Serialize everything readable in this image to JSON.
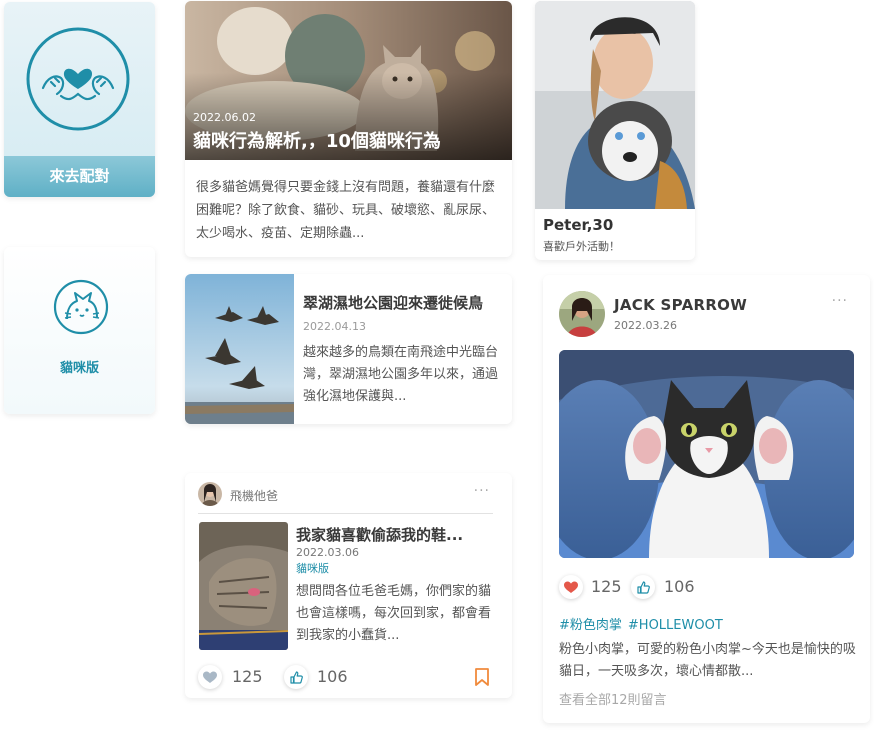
{
  "match_tile": {
    "cta_label": "來去配對",
    "icon": "heart-hands-icon"
  },
  "cat_board_tile": {
    "label": "貓咪版",
    "icon": "cat-face-icon"
  },
  "featured_article": {
    "date": "2022.06.02",
    "title": "貓咪行為解析,，10個貓咪行為",
    "excerpt": "很多貓爸媽覺得只要金錢上沒有問題，養貓還有什麼困難呢？除了飲食、貓砂、玩具、破壞慾、亂尿尿、太少喝水、疫苗、定期除蟲..."
  },
  "profile_card": {
    "name": "Peter,30",
    "bio": "喜歡戶外活動！"
  },
  "bird_article": {
    "title": "翠湖濕地公園迎來遷徙候鳥",
    "date": "2022.04.13",
    "excerpt": "越來越多的鳥類在南飛途中光臨台灣，翠湖濕地公園多年以來，通過強化濕地保護與..."
  },
  "forum_post": {
    "author": "飛機他爸",
    "more": "···",
    "title": "我家貓喜歡偷舔我的鞋...",
    "date": "2022.03.06",
    "board": "貓咪版",
    "excerpt": "想問問各位毛爸毛媽，你們家的貓也會這樣嗎，每次回到家，都會看到我家的小蠢貨...",
    "likes": "125",
    "thumbs": "106"
  },
  "feed_post": {
    "author": "JACK SPARROW",
    "date": "2022.03.26",
    "more": "···",
    "likes": "125",
    "thumbs": "106",
    "tags": [
      "#粉色肉掌",
      "#HOLLEWOOT"
    ],
    "body": "粉色小肉掌，可愛的粉色小肉掌~今天也是愉快的吸貓日，一天吸多次，壞心情都散...",
    "view_comments": "查看全部12則留言"
  },
  "colors": {
    "accent": "#1f8ea8",
    "heart_active": "#e4584a",
    "bookmark": "#f08a3c"
  }
}
